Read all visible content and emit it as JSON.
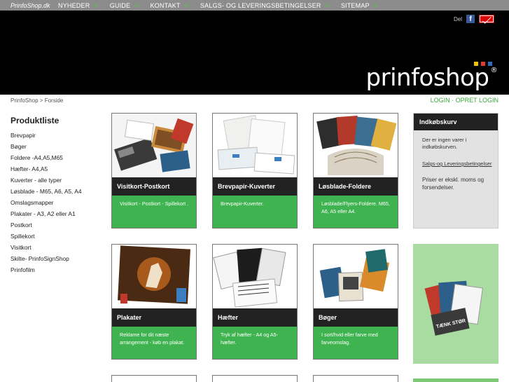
{
  "topnav": {
    "brand": "PrinfoShop.dk",
    "items": [
      "NYHEDER",
      "GUIDE",
      "KONTAKT",
      "SALGS- OG LEVERINGSBETINGELSER",
      "SITEMAP"
    ],
    "arrow": ">"
  },
  "header": {
    "share_label": "Del",
    "logo_text": "prinfoshop",
    "logo_mark": "®",
    "dot_colors": [
      "#f2c100",
      "#e03a2f",
      "#2e6cc0"
    ]
  },
  "breadcrumb": "PrinfoShop > Forside",
  "login": "LOGIN · OPRET LOGIN",
  "sidebar": {
    "title": "Produktliste",
    "items": [
      "Brevpapir",
      "Bøger",
      "Foldere -A4,A5,M65",
      "Hæfter- A4,A5",
      "Kuverter - alle typer",
      "Løsblade - M65, A6, A5, A4",
      "Omslagsmapper",
      "Plakater - A3, A2 eller A1",
      "Postkort",
      "Spillekort",
      "Visitkort",
      "Skilte- PrinfoSignShop",
      "Prinfofilm"
    ]
  },
  "products": [
    {
      "title": "Visitkort-Postkort",
      "desc": "Visitkort - Postkort - Spillekort ."
    },
    {
      "title": "Brevpapir-Kuverter",
      "desc": "Brevpapir-Kuverter."
    },
    {
      "title": "Løsblade-Foldere",
      "desc": "Løsblade/Flyers-Foldere. M65, A6, A5 eller A4."
    },
    {
      "title": "Plakater",
      "desc": "Reklame for dit næste arrangement - køb en plakat."
    },
    {
      "title": "Hæfter",
      "desc": "Tryk af hæfter - A4 og A5-hæfter."
    },
    {
      "title": "Bøger",
      "desc": "I sort/hvid eller farve  med farveomslag."
    }
  ],
  "cart": {
    "title": "Indkøbskurv",
    "empty_text": "Der er ingen varer i indkøbskurven.",
    "terms_link": "Salgs-og Leveringsbetingelser",
    "price_note": "Priser er ekskl. moms og forsendelser."
  },
  "promo": {
    "stamp_text": "TÆNK STØR"
  },
  "colors": {
    "accent_green": "#3fb34f",
    "header_bg": "#000000",
    "nav_bg": "#8c8c8c"
  }
}
